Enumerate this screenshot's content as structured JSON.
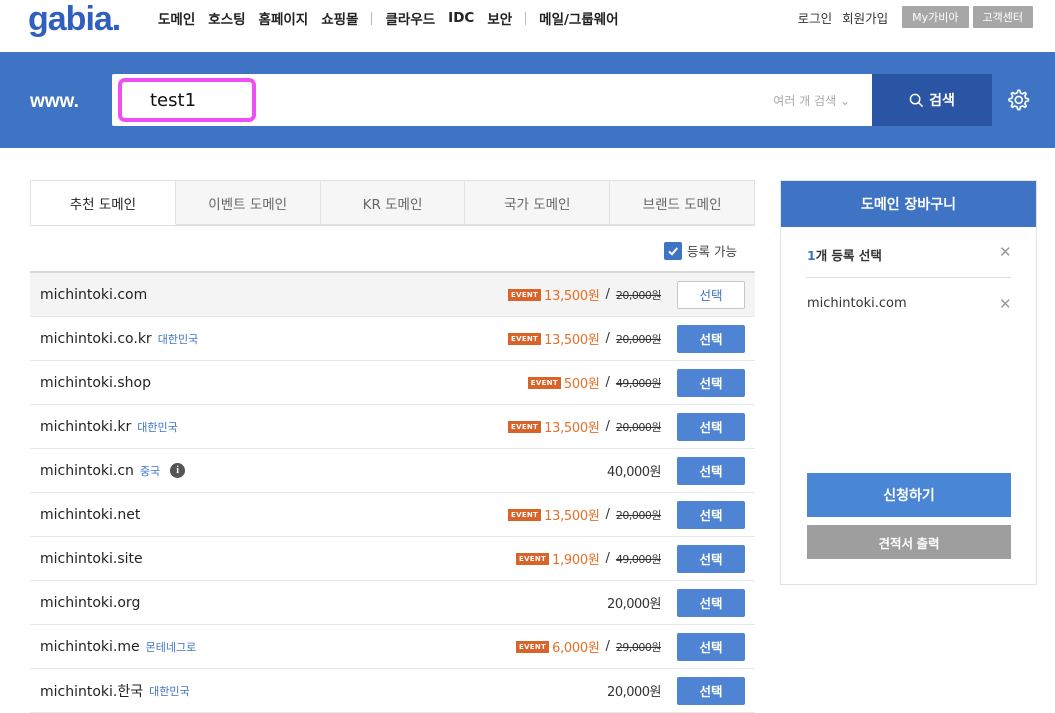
{
  "header": {
    "logo": "gabia.",
    "menu": [
      "도메인",
      "호스팅",
      "홈페이지",
      "쇼핑몰",
      "클라우드",
      "IDC",
      "보안",
      "메일/그룹웨어"
    ],
    "login": "로그인",
    "signup": "회원가입",
    "mygabia": "My가비아",
    "support": "고객센터"
  },
  "search": {
    "prefix": "www.",
    "value": "test1",
    "multi_label": "여러 개 검색 ⌄",
    "button_label": "검색"
  },
  "tabs": [
    "추천 도메인",
    "이벤트 도메인",
    "KR 도메인",
    "국가 도메인",
    "브랜드 도메인"
  ],
  "available_filter": {
    "label": "등록 가능",
    "checked": true
  },
  "domains": [
    {
      "name": "michintoki.com",
      "country": "",
      "info": false,
      "event": "EVENT",
      "sale": "13,500원",
      "slash": "/",
      "original": "20,000원",
      "price": "",
      "button": "선택",
      "selected": true
    },
    {
      "name": "michintoki.co.kr",
      "country": "대한민국",
      "info": false,
      "event": "EVENT",
      "sale": "13,500원",
      "slash": "/",
      "original": "20,000원",
      "price": "",
      "button": "선택",
      "selected": false
    },
    {
      "name": "michintoki.shop",
      "country": "",
      "info": false,
      "event": "EVENT",
      "sale": "500원",
      "slash": "/",
      "original": "49,000원",
      "price": "",
      "button": "선택",
      "selected": false
    },
    {
      "name": "michintoki.kr",
      "country": "대한민국",
      "info": false,
      "event": "EVENT",
      "sale": "13,500원",
      "slash": "/",
      "original": "20,000원",
      "price": "",
      "button": "선택",
      "selected": false
    },
    {
      "name": "michintoki.cn",
      "country": "중국",
      "info": true,
      "event": "",
      "sale": "",
      "slash": "",
      "original": "",
      "price": "40,000원",
      "button": "선택",
      "selected": false
    },
    {
      "name": "michintoki.net",
      "country": "",
      "info": false,
      "event": "EVENT",
      "sale": "13,500원",
      "slash": "/",
      "original": "20,000원",
      "price": "",
      "button": "선택",
      "selected": false
    },
    {
      "name": "michintoki.site",
      "country": "",
      "info": false,
      "event": "EVENT",
      "sale": "1,900원",
      "slash": "/",
      "original": "49,000원",
      "price": "",
      "button": "선택",
      "selected": false
    },
    {
      "name": "michintoki.org",
      "country": "",
      "info": false,
      "event": "",
      "sale": "",
      "slash": "",
      "original": "",
      "price": "20,000원",
      "button": "선택",
      "selected": false
    },
    {
      "name": "michintoki.me",
      "country": "몬테네그로",
      "info": false,
      "event": "EVENT",
      "sale": "6,000원",
      "slash": "/",
      "original": "29,000원",
      "price": "",
      "button": "선택",
      "selected": false
    },
    {
      "name": "michintoki.한국",
      "country": "대한민국",
      "info": false,
      "event": "",
      "sale": "",
      "slash": "",
      "original": "",
      "price": "20,000원",
      "button": "선택",
      "selected": false
    }
  ],
  "cart": {
    "title": "도메인 장바구니",
    "count_num": "1",
    "count_text": "개 등록 선택",
    "items": [
      "michintoki.com"
    ],
    "apply": "신청하기",
    "quote": "견적서 출력"
  },
  "colors": {
    "brand_blue": "#3f74c4",
    "search_button": "#2a55a4",
    "event_badge": "#d9642a",
    "sale_price": "#e4702a",
    "highlight_border": "#ee4ff2"
  }
}
